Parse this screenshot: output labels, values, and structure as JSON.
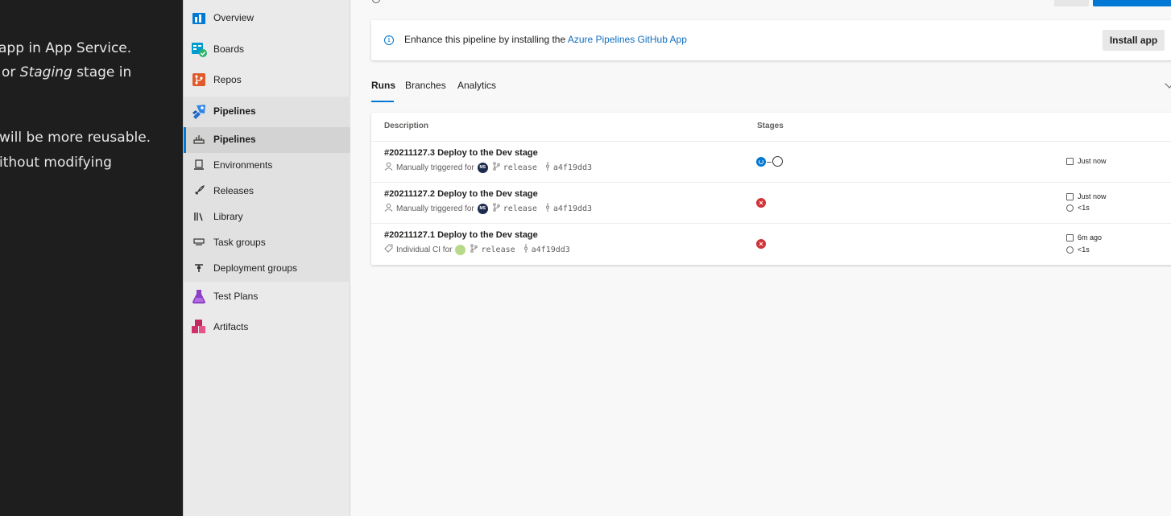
{
  "doc_panel": {
    "lines": [
      {
        "text": "app in App Service."
      },
      {
        "prefix": "or ",
        "italic": "Staging",
        "suffix": " stage in"
      },
      {
        "text": "will be more reusable."
      },
      {
        "text": "ithout modifying"
      }
    ]
  },
  "sidebar": {
    "items": [
      {
        "label": "Overview",
        "icon": "overview-icon"
      },
      {
        "label": "Boards",
        "icon": "boards-icon"
      },
      {
        "label": "Repos",
        "icon": "repos-icon"
      },
      {
        "label": "Pipelines",
        "icon": "pipelines-icon"
      },
      {
        "label": "Pipelines",
        "icon": "pipelines-sub-icon"
      },
      {
        "label": "Environments",
        "icon": "environments-icon"
      },
      {
        "label": "Releases",
        "icon": "releases-icon"
      },
      {
        "label": "Library",
        "icon": "library-icon"
      },
      {
        "label": "Task groups",
        "icon": "task-groups-icon"
      },
      {
        "label": "Deployment groups",
        "icon": "deployment-groups-icon"
      },
      {
        "label": "Test Plans",
        "icon": "test-plans-icon"
      },
      {
        "label": "Artifacts",
        "icon": "artifacts-icon"
      }
    ]
  },
  "banner": {
    "message": "Enhance this pipeline by installing the ",
    "link": "Azure Pipelines GitHub App",
    "button": "Install app"
  },
  "tabs": [
    "Runs",
    "Branches",
    "Analytics"
  ],
  "table": {
    "headers": {
      "description": "Description",
      "stages": "Stages"
    },
    "rows": [
      {
        "title": "#20211127.3 Deploy to the Dev stage",
        "trigger": "Manually triggered for",
        "avatar": "MS",
        "branch": "release",
        "commit": "a4f19dd3",
        "stages": [
          "in-progress",
          "not-started"
        ],
        "time": "Just now",
        "duration": ""
      },
      {
        "title": "#20211127.2 Deploy to the Dev stage",
        "trigger": "Manually triggered for",
        "avatar": "MS",
        "branch": "release",
        "commit": "a4f19dd3",
        "stages": [
          "failed"
        ],
        "time": "Just now",
        "duration": "<1s"
      },
      {
        "title": "#20211127.1 Deploy to the Dev stage",
        "trigger": "Individual CI for",
        "avatar": "",
        "branch": "release",
        "commit": "a4f19dd3",
        "stages": [
          "failed"
        ],
        "time": "6m ago",
        "duration": "<1s"
      }
    ]
  },
  "colors": {
    "accent": "#0078d4",
    "failed": "#d13438",
    "sidebar_bg": "#eaeaea",
    "doc_bg": "#1e1e1e"
  }
}
